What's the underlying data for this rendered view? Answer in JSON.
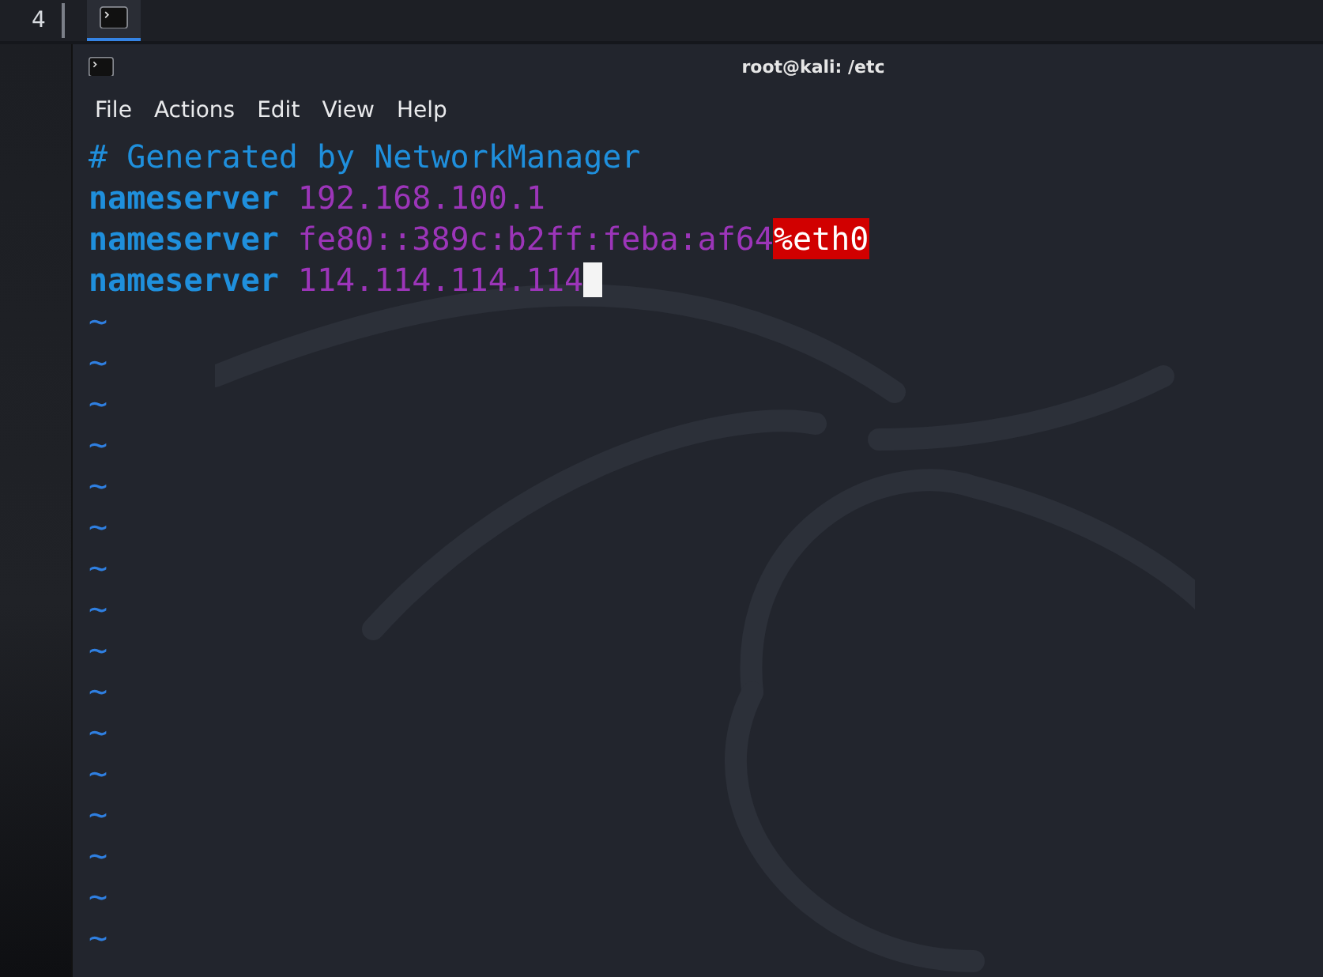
{
  "taskbar": {
    "workspace": "4",
    "tasks": [
      {
        "kind": "terminal",
        "selected": true
      }
    ]
  },
  "window": {
    "title": "root@kali: /etc"
  },
  "menu": [
    "File",
    "Actions",
    "Edit",
    "View",
    "Help"
  ],
  "editor": {
    "lines": [
      {
        "kind": "comment",
        "text": "# Generated by NetworkManager"
      },
      {
        "kind": "entry",
        "keyword": "nameserver",
        "value": "192.168.100.1",
        "cursor": false
      },
      {
        "kind": "entry",
        "keyword": "nameserver",
        "value": "fe80::389c:b2ff:feba:af64",
        "error": "%eth0",
        "cursor": false
      },
      {
        "kind": "entry",
        "keyword": "nameserver",
        "value": "114.114.114.114",
        "cursor": true
      }
    ],
    "empty_lines": [
      "~",
      "~",
      "~",
      "~",
      "~",
      "~",
      "~",
      "~",
      "~",
      "~",
      "~",
      "~",
      "~",
      "~",
      "~",
      "~"
    ]
  }
}
